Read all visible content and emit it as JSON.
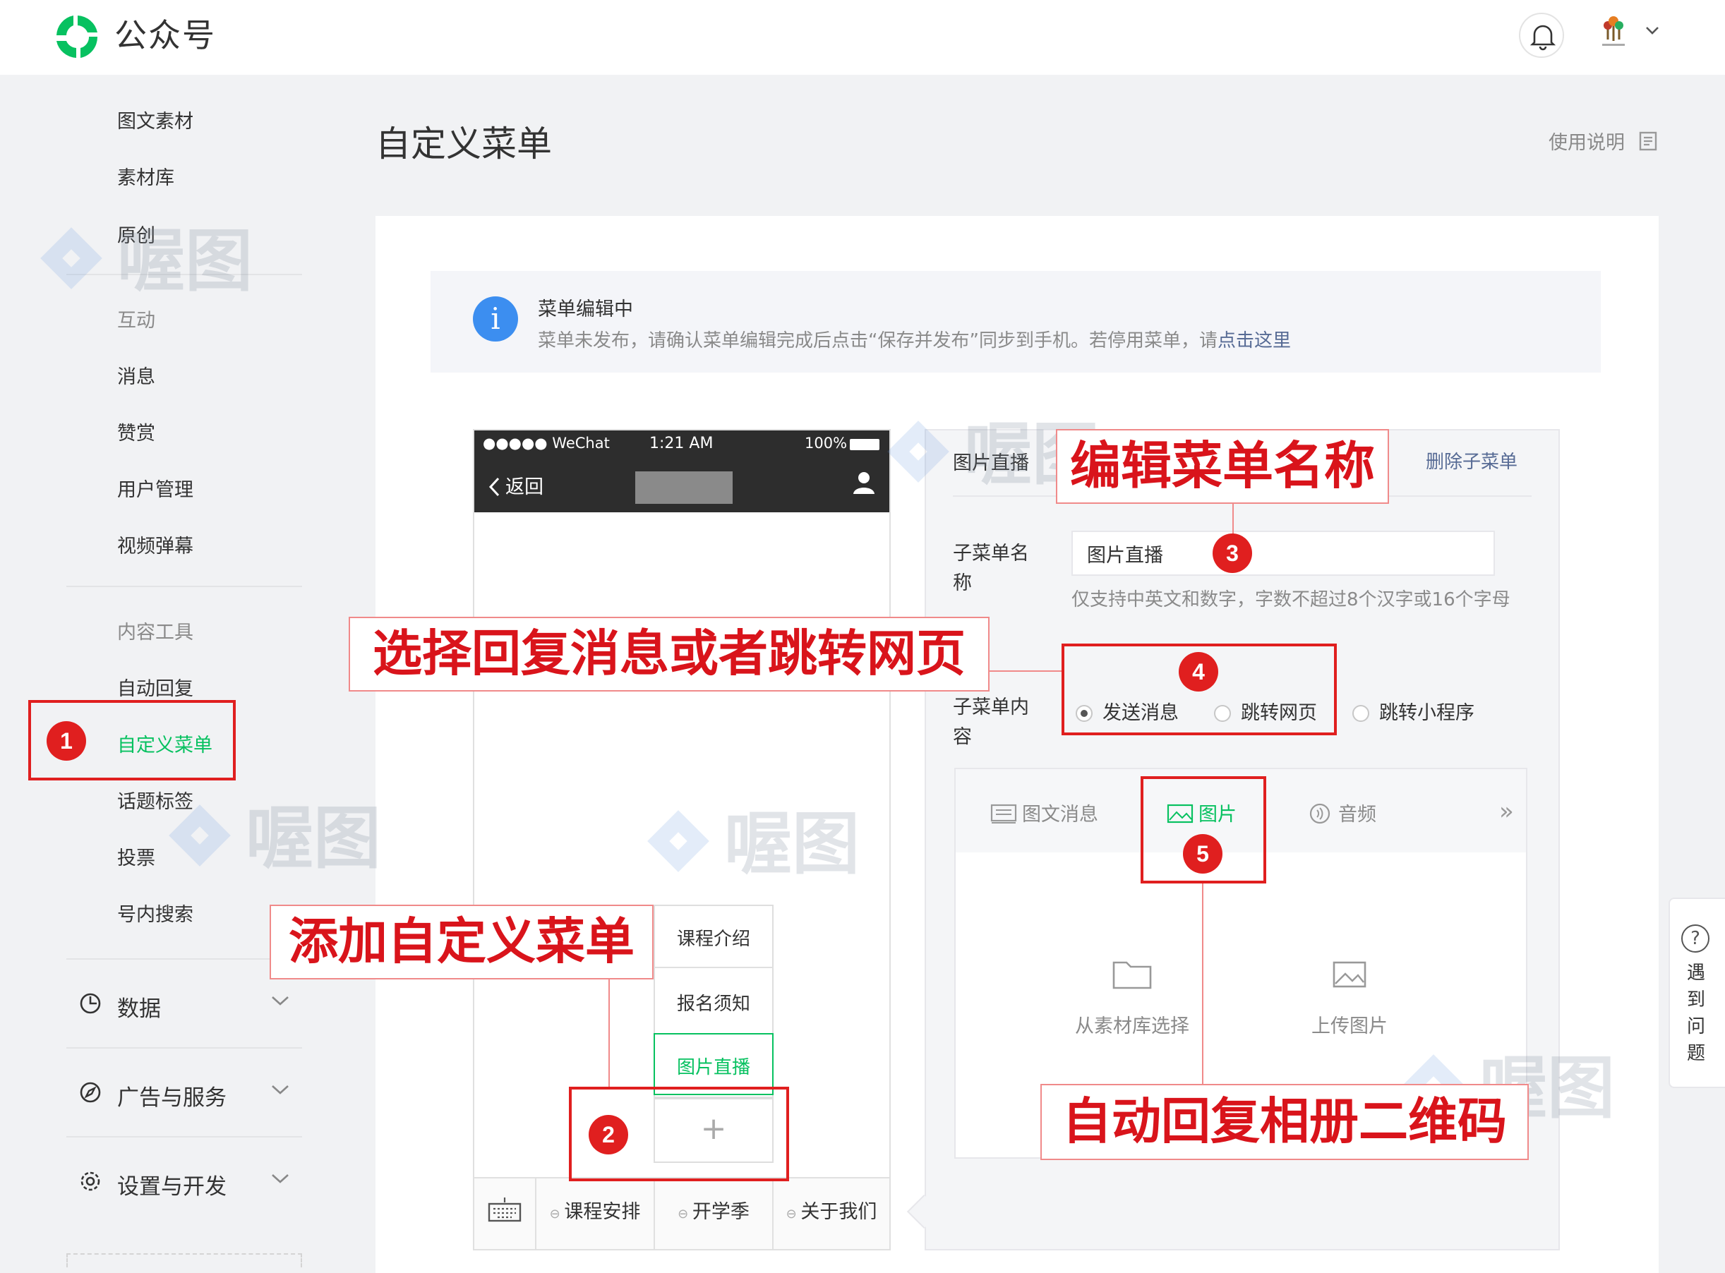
{
  "header": {
    "app_title": "公众号"
  },
  "sidebar": {
    "items": [
      "图文素材",
      "素材库",
      "原创"
    ],
    "interact_header": "互动",
    "interact_items": [
      "消息",
      "赞赏",
      "用户管理",
      "视频弹幕"
    ],
    "tools_header": "内容工具",
    "tools_items": [
      "自动回复",
      "自定义菜单",
      "话题标签",
      "投票",
      "号内搜索"
    ],
    "groups": [
      "数据",
      "广告与服务",
      "设置与开发"
    ]
  },
  "main": {
    "title": "自定义菜单",
    "help_link": "使用说明",
    "notice": {
      "title": "菜单编辑中",
      "desc": "菜单未发布，请确认菜单编辑完成后点击“保存并发布”同步到手机。若停用菜单，请",
      "link": "点击这里",
      "icon": "i"
    }
  },
  "phone": {
    "status_carrier": "●●●●● WeChat",
    "status_time": "1:21 AM",
    "status_battery": "100%",
    "back_label": "返回",
    "submenu": [
      "课程介绍",
      "报名须知",
      "图片直播"
    ],
    "add_symbol": "+",
    "bottom_menu": [
      "课程安排",
      "开学季",
      "关于我们"
    ]
  },
  "editor": {
    "title": "图片直播",
    "delete_label": "删除子菜单",
    "name_label": "子菜单名称",
    "name_value": "图片直播",
    "name_hint": "仅支持中英文和数字，字数不超过8个汉字或16个字母",
    "content_label": "子菜单内容",
    "radio_options": [
      "发送消息",
      "跳转网页",
      "跳转小程序"
    ],
    "media_tabs": [
      "图文消息",
      "图片",
      "音频"
    ],
    "more_symbol": "»",
    "media_options": [
      "从素材库选择",
      "上传图片"
    ]
  },
  "help_float": {
    "q": "?",
    "text": "遇到问题"
  },
  "annotations": {
    "badges": [
      "1",
      "2",
      "3",
      "4",
      "5"
    ],
    "labels": [
      "编辑菜单名称",
      "选择回复消息或者跳转网页",
      "添加自定义菜单",
      "自动回复相册二维码"
    ]
  },
  "watermark": "喔图",
  "colors": {
    "brand_green": "#07c160",
    "annotation_red": "#e01f1f",
    "link_blue": "#576b95",
    "info_blue": "#3c8ef0"
  }
}
